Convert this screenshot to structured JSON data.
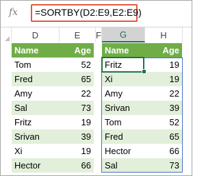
{
  "formula_bar": {
    "fx_label": "fx",
    "formula": "=SORTBY(D2:E9,E2:E9)",
    "accent_color": "#e05a3e"
  },
  "columns": [
    "D",
    "E",
    "F",
    "G",
    "H"
  ],
  "selected_column": "G",
  "source_table": {
    "headers": [
      "Name",
      "Age"
    ],
    "rows": [
      [
        "Tom",
        "52"
      ],
      [
        "Fred",
        "65"
      ],
      [
        "Amy",
        "22"
      ],
      [
        "Sal",
        "73"
      ],
      [
        "Fritz",
        "19"
      ],
      [
        "Srivan",
        "39"
      ],
      [
        "Xi",
        "19"
      ],
      [
        "Hector",
        "66"
      ]
    ]
  },
  "result_table": {
    "headers": [
      "Name",
      "Age"
    ],
    "rows": [
      [
        "Fritz",
        "19"
      ],
      [
        "Xi",
        "19"
      ],
      [
        "Amy",
        "22"
      ],
      [
        "Srivan",
        "39"
      ],
      [
        "Tom",
        "52"
      ],
      [
        "Fred",
        "65"
      ],
      [
        "Hector",
        "66"
      ],
      [
        "Sal",
        "73"
      ]
    ]
  },
  "colors": {
    "header_green": "#70ad47",
    "band_green": "#e2efda",
    "selection_green": "#217346",
    "spill_blue": "#4472c4"
  }
}
